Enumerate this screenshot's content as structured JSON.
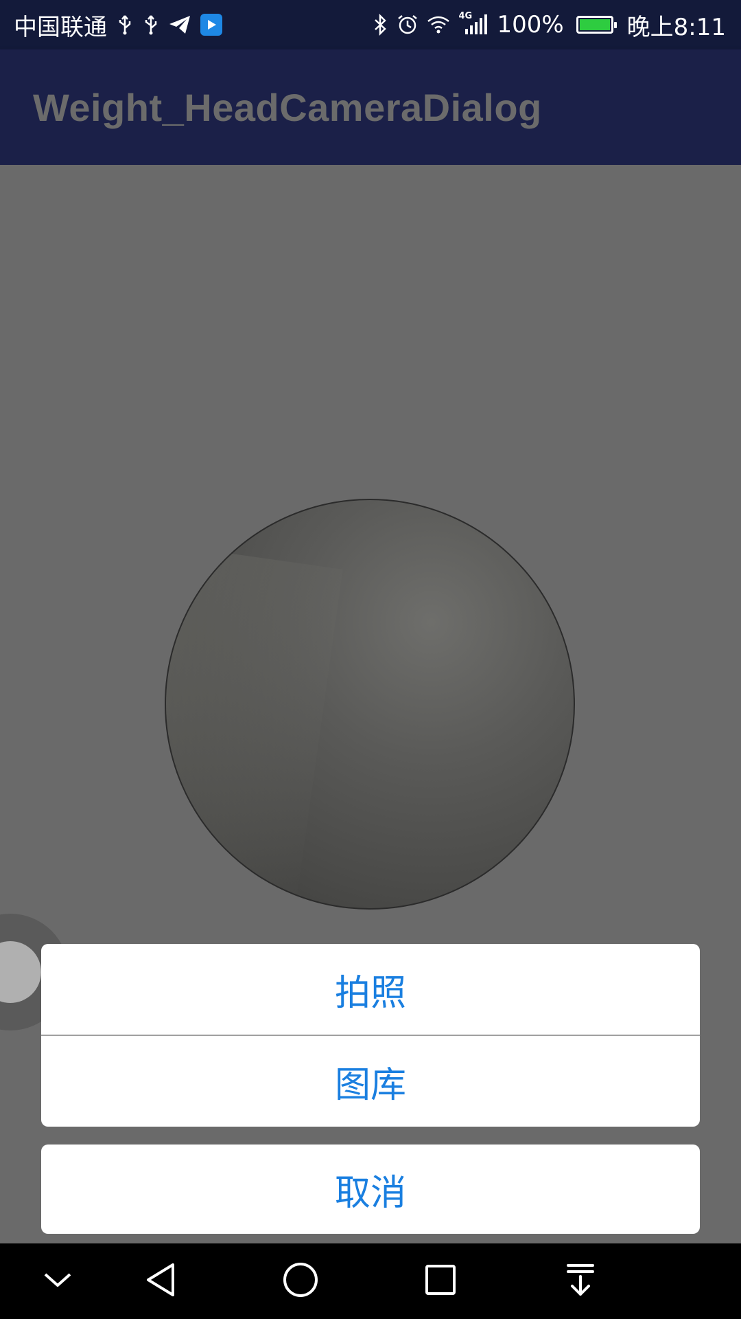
{
  "status_bar": {
    "carrier": "中国联通",
    "network": "4G",
    "battery": "100%",
    "battery_level": 1.0,
    "time": "晚上8:11",
    "colors": {
      "background": "#131a3a",
      "battery_fill": "#2ecc40"
    }
  },
  "app_bar": {
    "title": "Weight_HeadCameraDialog",
    "colors": {
      "background": "#1b2048",
      "title": "#6b6b6b"
    }
  },
  "action_sheet": {
    "options": [
      {
        "label": "拍照"
      },
      {
        "label": "图库"
      }
    ],
    "cancel_label": "取消",
    "colors": {
      "text": "#1a7fe0",
      "background": "#ffffff"
    }
  },
  "nav_bar": {
    "buttons": [
      {
        "icon": "chevron-down-icon"
      },
      {
        "icon": "back-triangle-icon"
      },
      {
        "icon": "home-circle-icon"
      },
      {
        "icon": "recents-square-icon"
      },
      {
        "icon": "notification-pull-icon"
      }
    ]
  }
}
